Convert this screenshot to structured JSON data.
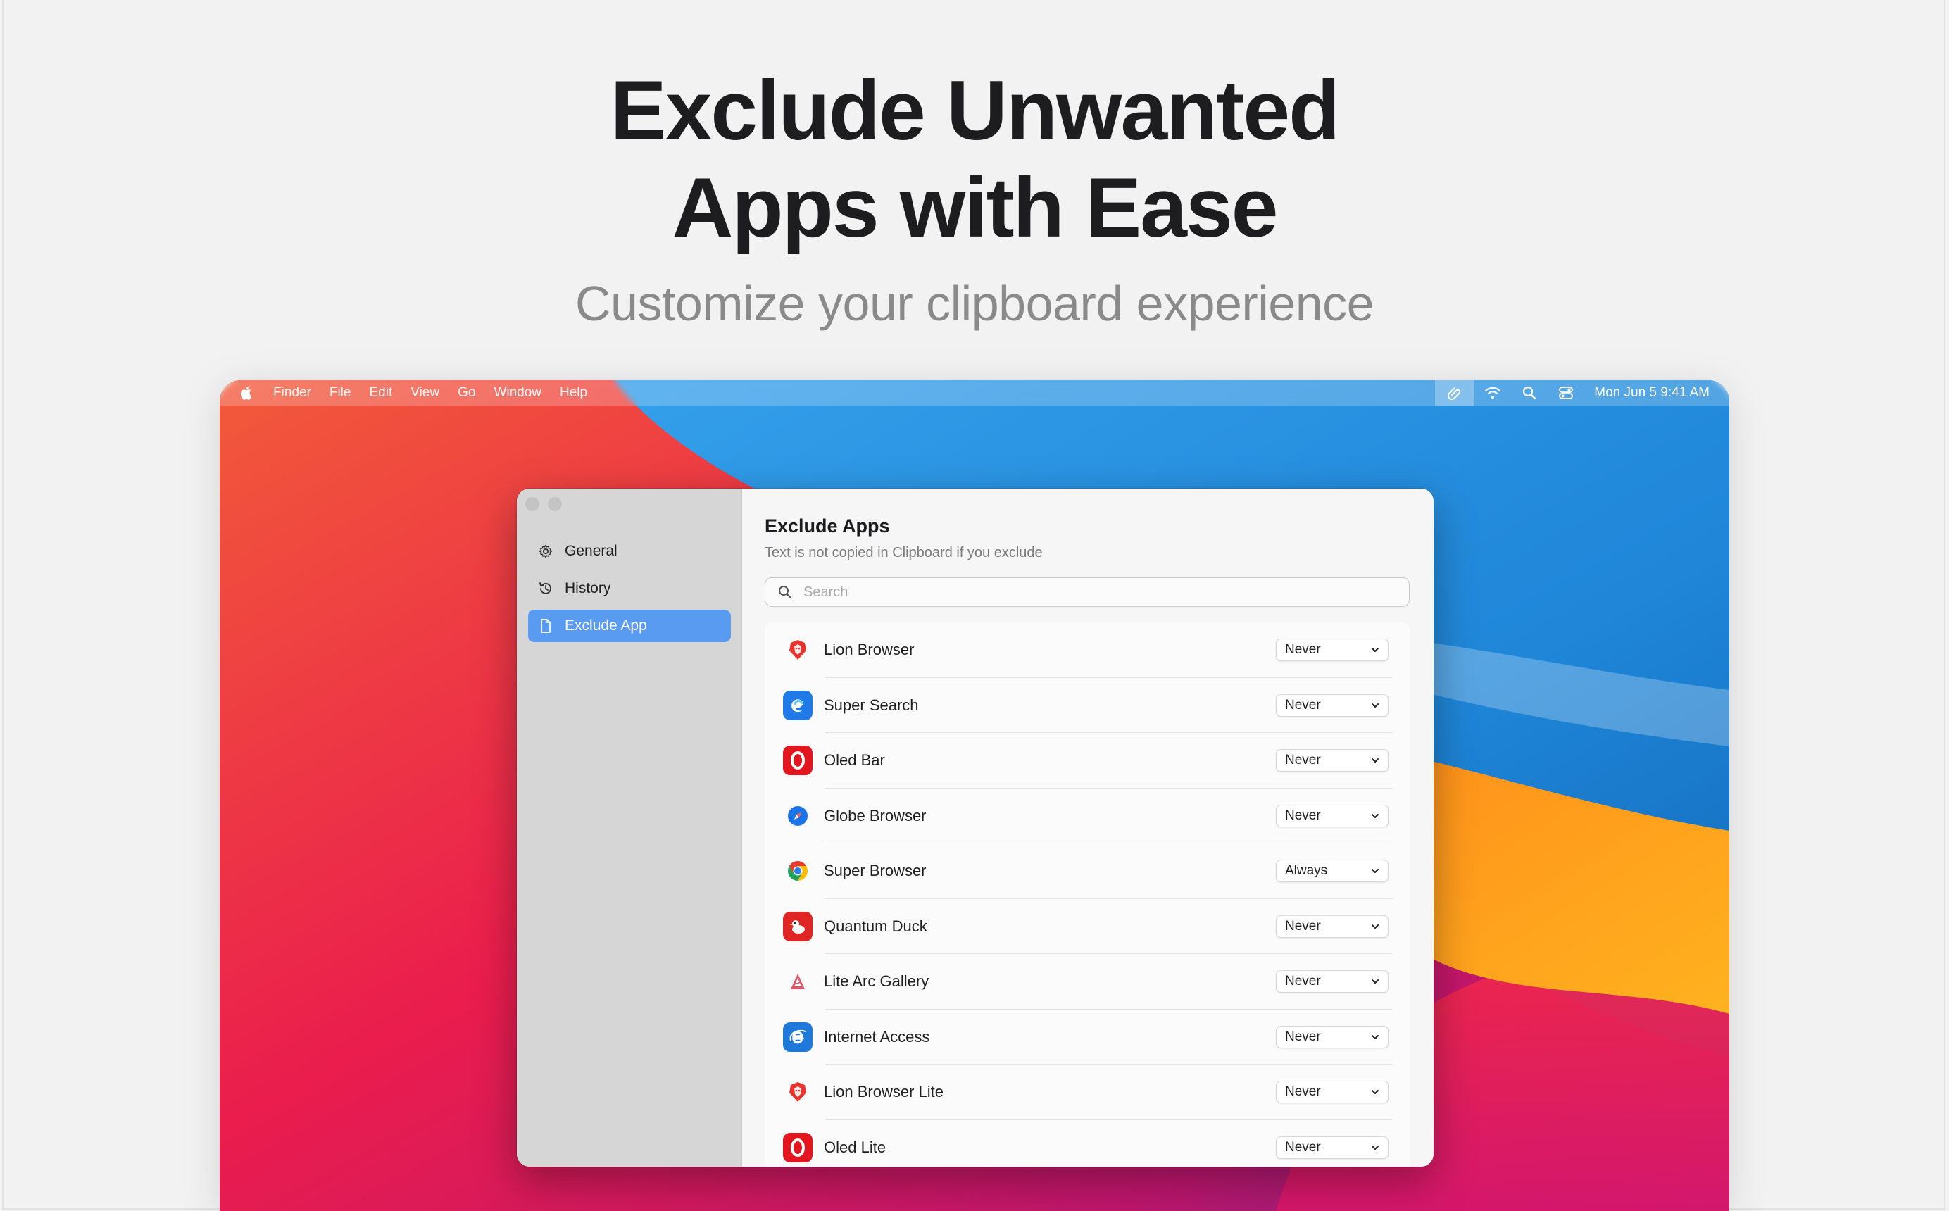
{
  "hero": {
    "title_line1": "Exclude Unwanted",
    "title_line2": "Apps with Ease",
    "subtitle": "Customize your clipboard experience"
  },
  "menubar": {
    "items": [
      "Finder",
      "File",
      "Edit",
      "View",
      "Go",
      "Window",
      "Help"
    ],
    "clock": "Mon Jun 5  9:41 AM",
    "status_icons": [
      "clipboard-app-icon",
      "wifi-icon",
      "spotlight-search-icon",
      "control-center-icon"
    ]
  },
  "sidebar": {
    "items": [
      {
        "label": "General",
        "icon": "gear-icon"
      },
      {
        "label": "History",
        "icon": "history-icon"
      },
      {
        "label": "Exclude App",
        "icon": "document-icon",
        "selected": true
      }
    ]
  },
  "content": {
    "title": "Exclude Apps",
    "subtitle": "Text is not copied in Clipboard if you exclude",
    "search_placeholder": "Search"
  },
  "apps": [
    {
      "name": "Lion Browser",
      "value": "Never",
      "icon": "lion-browser-icon",
      "color": "#e8342d"
    },
    {
      "name": "Super Search",
      "value": "Never",
      "icon": "super-search-icon",
      "color": "#1f7ae8"
    },
    {
      "name": "Oled Bar",
      "value": "Never",
      "icon": "oled-bar-icon",
      "color": "#e3161f"
    },
    {
      "name": "Globe Browser",
      "value": "Never",
      "icon": "globe-browser-icon",
      "color": "#1a74e8"
    },
    {
      "name": "Super Browser",
      "value": "Always",
      "icon": "super-browser-icon",
      "color": "#e33b2e"
    },
    {
      "name": "Quantum Duck",
      "value": "Never",
      "icon": "quantum-duck-icon",
      "color": "#e02525"
    },
    {
      "name": "Lite Arc Gallery",
      "value": "Never",
      "icon": "lite-arc-gallery-icon",
      "color": "#e2546a"
    },
    {
      "name": "Internet Access",
      "value": "Never",
      "icon": "internet-access-icon",
      "color": "#1e79d8"
    },
    {
      "name": "Lion Browser Lite",
      "value": "Never",
      "icon": "lion-browser-lite-icon",
      "color": "#e8342d"
    },
    {
      "name": "Oled Lite",
      "value": "Never",
      "icon": "oled-lite-icon",
      "color": "#e3161f"
    }
  ]
}
